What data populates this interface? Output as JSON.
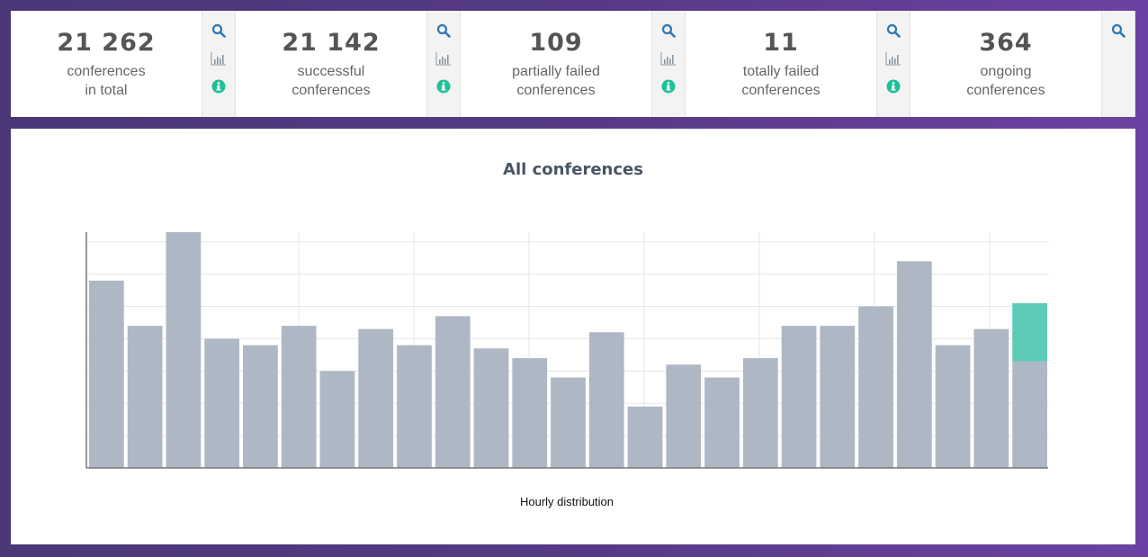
{
  "cards": [
    {
      "value": "21 262",
      "label_1": "conferences",
      "label_2": "in total",
      "tools": [
        "search-icon",
        "bar-chart-icon",
        "info-icon"
      ]
    },
    {
      "value": "21 142",
      "label_1": "successful",
      "label_2": "conferences",
      "tools": [
        "search-icon",
        "bar-chart-icon",
        "info-icon"
      ]
    },
    {
      "value": "109",
      "label_1": "partially failed",
      "label_2": "conferences",
      "tools": [
        "search-icon",
        "bar-chart-icon",
        "info-icon"
      ]
    },
    {
      "value": "11",
      "label_1": "totally failed",
      "label_2": "conferences",
      "tools": [
        "search-icon",
        "bar-chart-icon",
        "info-icon"
      ]
    },
    {
      "value": "364",
      "label_1": "ongoing",
      "label_2": "conferences",
      "tools": [
        "search-icon"
      ]
    }
  ],
  "colors": {
    "search": "#2b78b6",
    "chart_icon": "#8a96a3",
    "info": "#1fbf9a",
    "bar": "#aeb8c5",
    "highlight": "#5ccbb5"
  },
  "chart_data": {
    "type": "bar",
    "title": "All conferences",
    "xlabel": "Hourly distribution",
    "ylabel": "",
    "grid": true,
    "ylim": [
      0,
      73
    ],
    "values": [
      58,
      44,
      73,
      40,
      38,
      44,
      30,
      43,
      38,
      47,
      37,
      34,
      28,
      42,
      19,
      32,
      28,
      34,
      44,
      44,
      50,
      64,
      38,
      43,
      33
    ],
    "highlight_last_extra": 18
  }
}
